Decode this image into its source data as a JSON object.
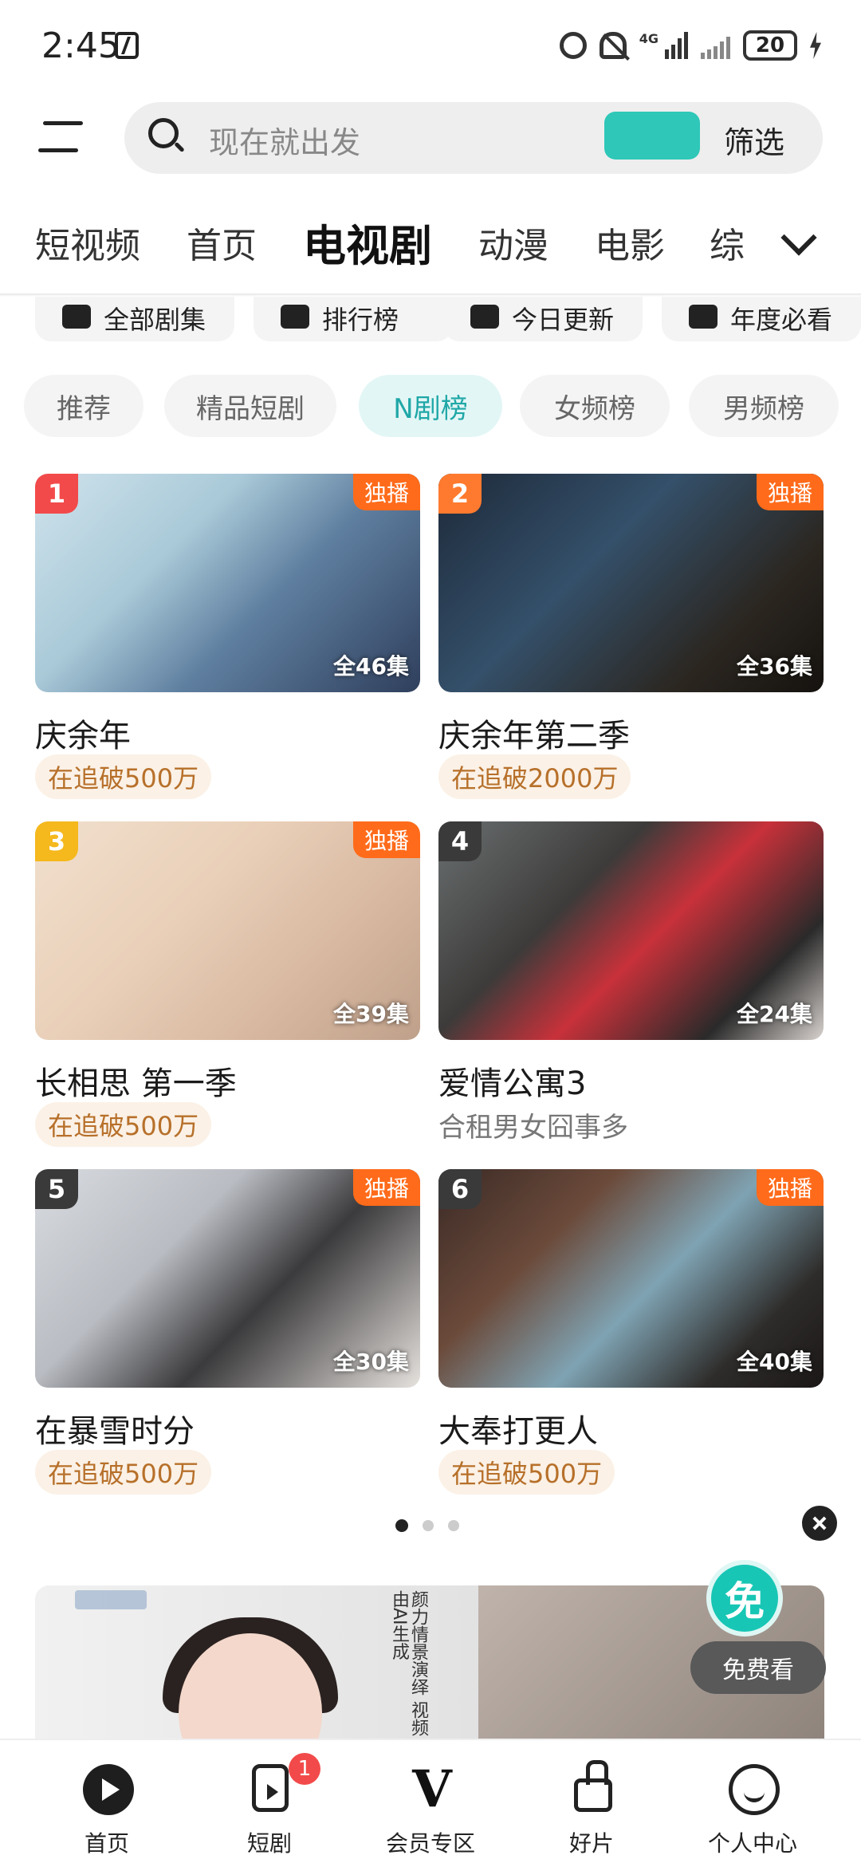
{
  "status_bar": {
    "time": "2:45",
    "network": "4G",
    "battery": "20"
  },
  "search": {
    "placeholder": "现在就出发",
    "filter_label": "筛选"
  },
  "category_tabs": [
    "短视频",
    "首页",
    "电视剧",
    "动漫",
    "电影",
    "综"
  ],
  "active_category": "电视剧",
  "quick_entries": [
    "全部剧集",
    "排行榜",
    "今日更新",
    "年度必看"
  ],
  "sub_tabs": [
    "推荐",
    "精品短剧",
    "N剧榜",
    "女频榜",
    "男频榜"
  ],
  "active_sub_tab": "N剧榜",
  "rankings": [
    {
      "rank": "1",
      "title": "庆余年",
      "badge": "独播",
      "episodes": "全46集",
      "tag": "在追破500万",
      "rank_color": "#f24a4a"
    },
    {
      "rank": "2",
      "title": "庆余年第二季",
      "badge": "独播",
      "episodes": "全36集",
      "tag": "在追破2000万",
      "rank_color": "#ff7a2e"
    },
    {
      "rank": "3",
      "title": "长相思 第一季",
      "badge": "独播",
      "episodes": "全39集",
      "tag": "在追破500万",
      "rank_color": "#f5b81d"
    },
    {
      "rank": "4",
      "title": "爱情公寓3",
      "badge": "",
      "episodes": "全24集",
      "subtitle": "合租男女囧事多",
      "rank_color": "#3a3a3a"
    },
    {
      "rank": "5",
      "title": "在暴雪时分",
      "badge": "独播",
      "episodes": "全30集",
      "tag": "在追破500万",
      "rank_color": "#3a3a3a"
    },
    {
      "rank": "6",
      "title": "大奉打更人",
      "badge": "独播",
      "episodes": "全40集",
      "tag": "在追破500万",
      "rank_color": "#3a3a3a"
    }
  ],
  "pager": {
    "pages": 3,
    "current": 1
  },
  "ad": {
    "vertical_text": "颜力情景演绎 视频由AI生成",
    "free_icon_text": "免",
    "free_button": "免费看"
  },
  "bottom_nav": [
    {
      "label": "首页",
      "icon": "play-home-icon"
    },
    {
      "label": "短剧",
      "icon": "short-drama-icon",
      "badge": "1"
    },
    {
      "label": "会员专区",
      "icon": "vip-icon",
      "glyph": "V"
    },
    {
      "label": "好片",
      "icon": "thumbs-up-icon"
    },
    {
      "label": "个人中心",
      "icon": "smile-profile-icon"
    }
  ],
  "colors": {
    "accent_teal": "#1fa7a7",
    "exclusive_badge": "#ff6b1a",
    "tag_text": "#b7702a"
  }
}
